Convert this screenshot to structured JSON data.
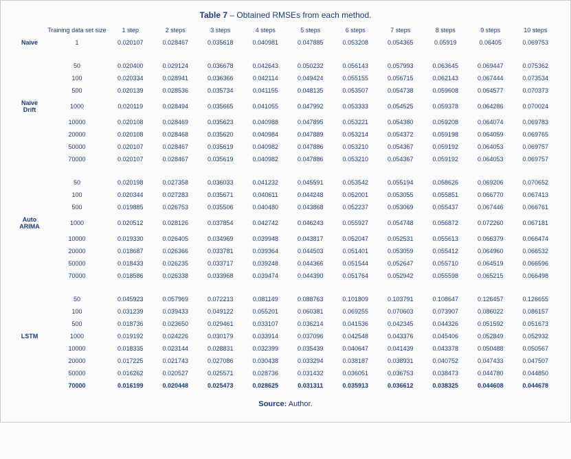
{
  "title_label": "Table 7",
  "title_rest": " – Obtained RMSEs from each method.",
  "source_label": "Source:",
  "source_value": " Author.",
  "headers": {
    "set_size": "Training data set size",
    "steps": [
      "1 step",
      "2 steps",
      "3 steps",
      "4 steps",
      "5 steps",
      "6 steps",
      "7 steps",
      "8 steps",
      "9 steps",
      "10 steps"
    ]
  },
  "methods": [
    {
      "name": "Naive",
      "label_mid_idx": 0,
      "rows": [
        {
          "size": "1",
          "v": [
            "0.020107",
            "0.028467",
            "0.035618",
            "0.040981",
            "0.047885",
            "0.053208",
            "0.054365",
            "0.05919",
            "0.06405",
            "0.069753"
          ]
        }
      ]
    },
    {
      "name": "Naive Drift",
      "label_mid_idx": 3,
      "rows": [
        {
          "size": "50",
          "v": [
            "0.020400",
            "0.029124",
            "0.036678",
            "0.042643",
            "0.050232",
            "0.056143",
            "0.057993",
            "0.063645",
            "0.069447",
            "0.075362"
          ]
        },
        {
          "size": "100",
          "v": [
            "0.020334",
            "0.028941",
            "0.036366",
            "0.042114",
            "0.049424",
            "0.055155",
            "0.056715",
            "0.062143",
            "0.067444",
            "0.073534"
          ]
        },
        {
          "size": "500",
          "v": [
            "0.020139",
            "0.028536",
            "0.035734",
            "0.041155",
            "0.048135",
            "0.053507",
            "0.054738",
            "0.059608",
            "0.064577",
            "0.070373"
          ]
        },
        {
          "size": "1000",
          "v": [
            "0.020119",
            "0.028494",
            "0.035665",
            "0.041055",
            "0.047992",
            "0.053333",
            "0.054525",
            "0.059378",
            "0.064286",
            "0.070024"
          ]
        },
        {
          "size": "10000",
          "v": [
            "0.020108",
            "0.028469",
            "0.035623",
            "0.040988",
            "0.047895",
            "0.053221",
            "0.054380",
            "0.059208",
            "0.064074",
            "0.069783"
          ]
        },
        {
          "size": "20000",
          "v": [
            "0.020108",
            "0.028468",
            "0.035620",
            "0.040984",
            "0.047889",
            "0.053214",
            "0.054372",
            "0.059198",
            "0.064059",
            "0.069765"
          ]
        },
        {
          "size": "50000",
          "v": [
            "0.020107",
            "0.028467",
            "0.035619",
            "0.040982",
            "0.047886",
            "0.053210",
            "0.054367",
            "0.059192",
            "0.064053",
            "0.069757"
          ]
        },
        {
          "size": "70000",
          "v": [
            "0.020107",
            "0.028467",
            "0.035619",
            "0.040982",
            "0.047886",
            "0.053210",
            "0.054367",
            "0.059192",
            "0.064053",
            "0.069757"
          ]
        }
      ]
    },
    {
      "name": "Auto ARIMA",
      "label_mid_idx": 3,
      "rows": [
        {
          "size": "50",
          "v": [
            "0.020198",
            "0.027358",
            "0.036033",
            "0.041232",
            "0.045591",
            "0.053542",
            "0.055194",
            "0.058626",
            "0.069206",
            "0.070652"
          ]
        },
        {
          "size": "100",
          "v": [
            "0.020344",
            "0.027283",
            "0.035671",
            "0.040611",
            "0.044248",
            "0.052001",
            "0.053055",
            "0.055851",
            "0.066770",
            "0.067413"
          ]
        },
        {
          "size": "500",
          "v": [
            "0.019885",
            "0.026753",
            "0.035506",
            "0.040480",
            "0.043868",
            "0.052237",
            "0.053069",
            "0.055437",
            "0.067446",
            "0.066761"
          ]
        },
        {
          "size": "1000",
          "v": [
            "0.020512",
            "0.028126",
            "0.037854",
            "0.042742",
            "0.046243",
            "0.055927",
            "0.054748",
            "0.056872",
            "0.072260",
            "0.067181"
          ]
        },
        {
          "size": "10000",
          "v": [
            "0.019330",
            "0.026405",
            "0.034969",
            "0.039948",
            "0.043817",
            "0.052047",
            "0.052531",
            "0.055613",
            "0.066379",
            "0.066474"
          ]
        },
        {
          "size": "20000",
          "v": [
            "0.018687",
            "0.026366",
            "0.033781",
            "0.039364",
            "0.044503",
            "0.051401",
            "0.053059",
            "0.055412",
            "0.064960",
            "0.066532"
          ]
        },
        {
          "size": "50000",
          "v": [
            "0.018433",
            "0.026235",
            "0.033717",
            "0.039248",
            "0.044366",
            "0.051544",
            "0.052647",
            "0.055710",
            "0.064519",
            "0.066596"
          ]
        },
        {
          "size": "70000",
          "v": [
            "0.018586",
            "0.026338",
            "0.033968",
            "0.039474",
            "0.044390",
            "0.051764",
            "0.052942",
            "0.055598",
            "0.065215",
            "0.066498"
          ]
        }
      ]
    },
    {
      "name": "LSTM",
      "label_mid_idx": 3,
      "rows": [
        {
          "size": "50",
          "v": [
            "0.045923",
            "0.057969",
            "0.072213",
            "0.081149",
            "0.088763",
            "0.101809",
            "0.103791",
            "0.108647",
            "0.126457",
            "0.126655"
          ]
        },
        {
          "size": "100",
          "v": [
            "0.031239",
            "0.039433",
            "0.049122",
            "0.055201",
            "0.060381",
            "0.069255",
            "0.070603",
            "0.073907",
            "0.086022",
            "0.086157"
          ]
        },
        {
          "size": "500",
          "v": [
            "0.018736",
            "0.023650",
            "0.029461",
            "0.033107",
            "0.036214",
            "0.041536",
            "0.042345",
            "0.044326",
            "0.051592",
            "0.051673"
          ]
        },
        {
          "size": "1000",
          "v": [
            "0.019192",
            "0.024226",
            "0.030179",
            "0.033914",
            "0.037096",
            "0.042548",
            "0.043376",
            "0.045406",
            "0.052849",
            "0.052932"
          ]
        },
        {
          "size": "10000",
          "v": [
            "0.018335",
            "0.023144",
            "0.028831",
            "0.032399",
            "0.035439",
            "0.040647",
            "0.041439",
            "0.043378",
            "0.050488",
            "0.050567"
          ]
        },
        {
          "size": "20000",
          "v": [
            "0.017225",
            "0.021743",
            "0.027086",
            "0.030438",
            "0.033294",
            "0.038187",
            "0.038931",
            "0.040752",
            "0.047433",
            "0.047507"
          ]
        },
        {
          "size": "50000",
          "v": [
            "0.016262",
            "0.020527",
            "0.025571",
            "0.028736",
            "0.031432",
            "0.036051",
            "0.036753",
            "0.038473",
            "0.044780",
            "0.044850"
          ]
        },
        {
          "size": "70000",
          "bold": true,
          "v": [
            "0.016199",
            "0.020448",
            "0.025473",
            "0.028625",
            "0.031311",
            "0.035913",
            "0.036612",
            "0.038325",
            "0.044608",
            "0.044678"
          ]
        }
      ]
    }
  ]
}
